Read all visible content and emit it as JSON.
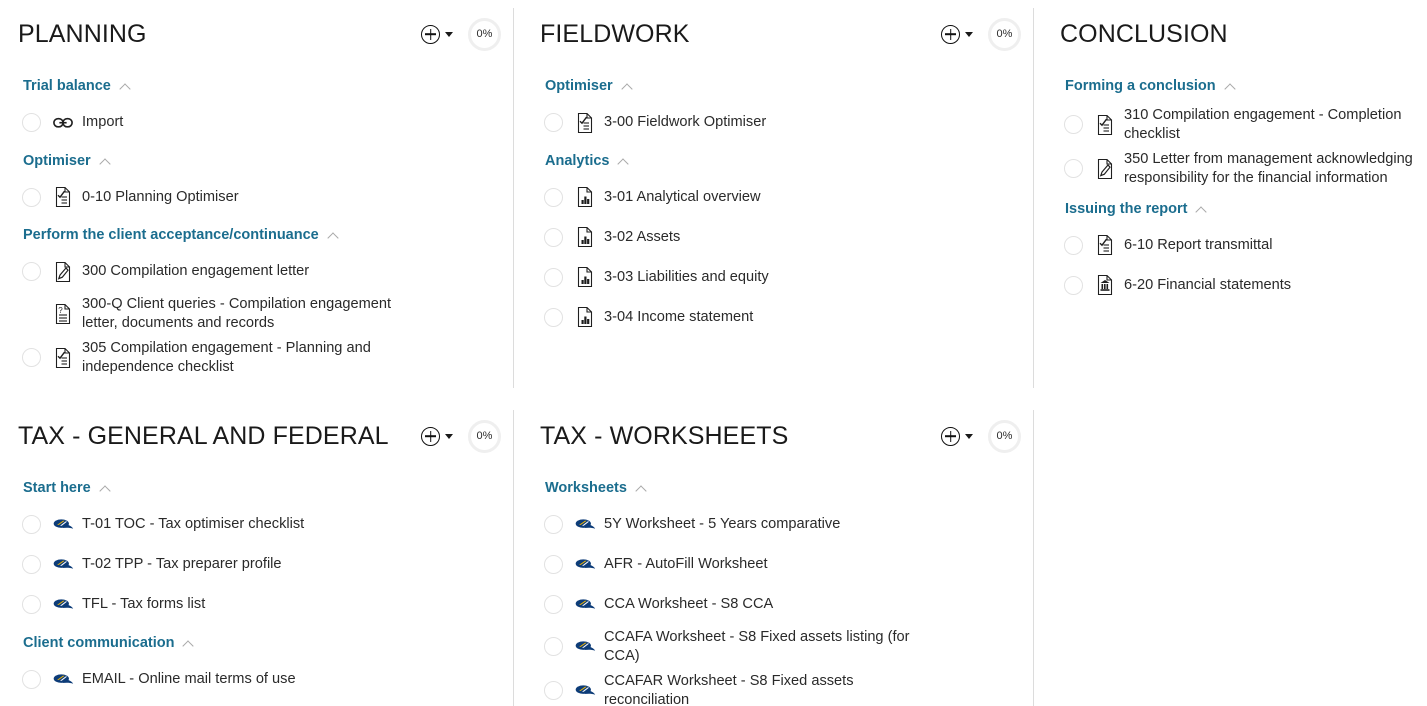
{
  "panels": [
    {
      "id": "planning",
      "title": "PLANNING",
      "progress": "0%",
      "add_label": "+",
      "has_actions": true,
      "groups": [
        {
          "title": "Trial balance",
          "items": [
            {
              "label": "Import",
              "icon": "link-icon",
              "checkbox": true
            }
          ]
        },
        {
          "title": "Optimiser",
          "items": [
            {
              "label": "0-10 Planning Optimiser",
              "icon": "document-checklist-icon",
              "checkbox": true
            }
          ]
        },
        {
          "title": "Perform the client acceptance/continuance",
          "items": [
            {
              "label": "300 Compilation engagement letter",
              "icon": "document-pencil-icon",
              "checkbox": true
            },
            {
              "label": "300-Q Client queries - Compilation engagement letter, documents and records",
              "icon": "document-question-icon",
              "checkbox": false
            },
            {
              "label": "305 Compilation engagement - Planning and independence checklist",
              "icon": "document-checklist-icon",
              "checkbox": true
            }
          ]
        }
      ]
    },
    {
      "id": "fieldwork",
      "title": "FIELDWORK",
      "progress": "0%",
      "add_label": "+",
      "has_actions": true,
      "groups": [
        {
          "title": "Optimiser",
          "items": [
            {
              "label": "3-00 Fieldwork Optimiser",
              "icon": "document-checklist-icon",
              "checkbox": true
            }
          ]
        },
        {
          "title": "Analytics",
          "items": [
            {
              "label": "3-01 Analytical overview",
              "icon": "document-chart-icon",
              "checkbox": true
            },
            {
              "label": "3-02 Assets",
              "icon": "document-chart-icon",
              "checkbox": true
            },
            {
              "label": "3-03 Liabilities and equity",
              "icon": "document-chart-icon",
              "checkbox": true
            },
            {
              "label": "3-04 Income statement",
              "icon": "document-chart-icon",
              "checkbox": true
            }
          ]
        }
      ]
    },
    {
      "id": "conclusion",
      "title": "CONCLUSION",
      "progress": null,
      "add_label": null,
      "has_actions": false,
      "groups": [
        {
          "title": "Forming a conclusion",
          "items": [
            {
              "label": "310 Compilation engagement - Completion checklist",
              "icon": "document-checklist-icon",
              "checkbox": true
            },
            {
              "label": "350 Letter from management acknowledging responsibility for the financial information",
              "icon": "document-pencil-icon",
              "checkbox": true
            }
          ]
        },
        {
          "title": "Issuing the report",
          "items": [
            {
              "label": "6-10 Report transmittal",
              "icon": "document-checklist-icon",
              "checkbox": true
            },
            {
              "label": "6-20 Financial statements",
              "icon": "document-bank-icon",
              "checkbox": true
            }
          ]
        }
      ]
    },
    {
      "id": "tax-general-and-federal",
      "title": "TAX - GENERAL AND FEDERAL",
      "progress": "0%",
      "add_label": "+",
      "has_actions": true,
      "groups": [
        {
          "title": "Start here",
          "items": [
            {
              "label": "T-01 TOC - Tax optimiser checklist",
              "icon": "taxprep-icon",
              "checkbox": true
            },
            {
              "label": "T-02 TPP - Tax preparer profile",
              "icon": "taxprep-icon",
              "checkbox": true
            },
            {
              "label": "TFL - Tax forms list",
              "icon": "taxprep-icon",
              "checkbox": true
            }
          ]
        },
        {
          "title": "Client communication",
          "items": [
            {
              "label": "EMAIL - Online mail terms of use",
              "icon": "taxprep-icon",
              "checkbox": true
            }
          ]
        }
      ]
    },
    {
      "id": "tax-worksheets",
      "title": "TAX - WORKSHEETS",
      "progress": "0%",
      "add_label": "+",
      "has_actions": true,
      "groups": [
        {
          "title": "Worksheets",
          "items": [
            {
              "label": "5Y Worksheet - 5 Years comparative",
              "icon": "taxprep-icon",
              "checkbox": true
            },
            {
              "label": "AFR - AutoFill Worksheet",
              "icon": "taxprep-icon",
              "checkbox": true
            },
            {
              "label": "CCA Worksheet - S8 CCA",
              "icon": "taxprep-icon",
              "checkbox": true
            },
            {
              "label": "CCAFA Worksheet - S8 Fixed assets listing (for CCA)",
              "icon": "taxprep-icon",
              "checkbox": true
            },
            {
              "label": "CCAFAR Worksheet - S8 Fixed assets reconciliation",
              "icon": "taxprep-icon",
              "checkbox": true
            }
          ]
        }
      ]
    }
  ],
  "colors": {
    "group_header": "#1b6d8e",
    "item_text": "#2a2a2a",
    "panel_title": "#1a1a1a",
    "divider": "#dcdcdc",
    "checkbox_border": "#e2e2e2",
    "progress_ring": "#efefef"
  }
}
